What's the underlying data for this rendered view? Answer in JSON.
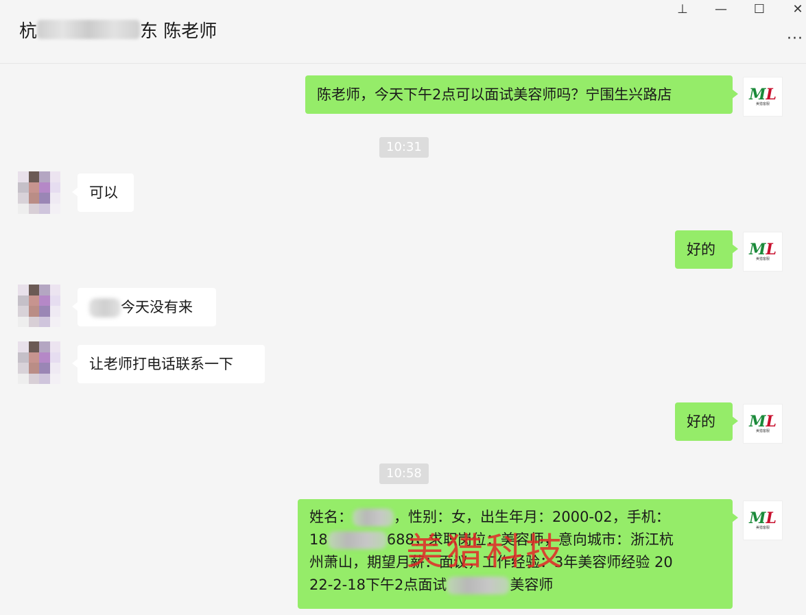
{
  "header": {
    "title_prefix": "杭",
    "title_suffix": "东 陈老师",
    "controls": {
      "pin": "⊥",
      "minimize": "—",
      "maximize": "☐",
      "close": "✕"
    },
    "more": "···"
  },
  "my_avatar": {
    "logo_m": "M",
    "logo_l": "L",
    "caption": "美猎客服"
  },
  "messages": {
    "m1": "陈老师，今天下午2点可以面试美容师吗？宁围生兴路店",
    "t1": "10:31",
    "m2": "可以",
    "m3": "好的",
    "m4": "今天没有来",
    "m5": "让老师打电话联系一下",
    "m6": "好的",
    "t2": "10:58",
    "m7": {
      "l1a": "姓名：",
      "l1b": "，性别：女，出生年月：2000-02，手机：",
      "l2a": "18",
      "l2b": "688，求职岗位：美容师，意向城市：浙江杭",
      "l3": "州萧山，期望月薪：面议，工作经验：3年美容师经验 20",
      "l4a": "22-2-18下午2点面试",
      "l4b": "美容师"
    }
  },
  "watermark": "美猎科技"
}
